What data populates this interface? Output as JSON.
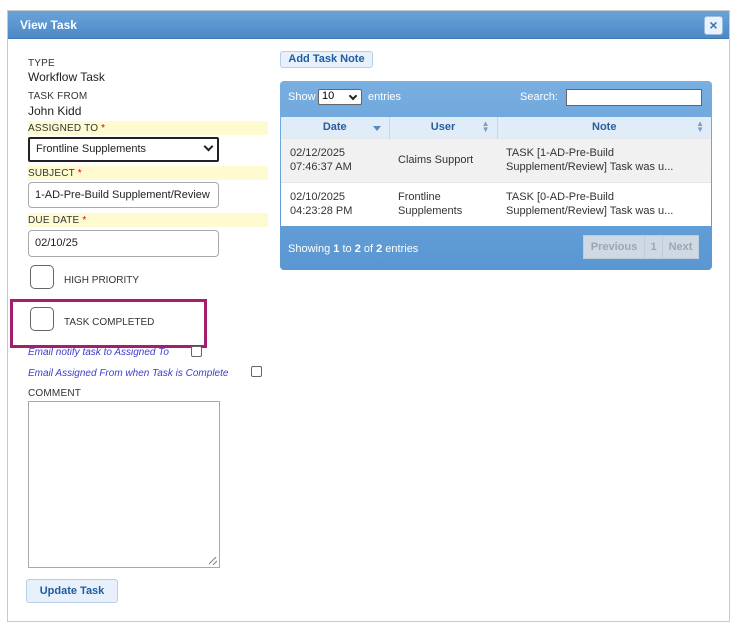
{
  "dialog": {
    "title": "View Task",
    "close_icon": "close-icon"
  },
  "form": {
    "type_label": "TYPE",
    "type_value": "Workflow Task",
    "task_from_label": "TASK FROM",
    "task_from_value": "John Kidd",
    "assigned_to_label": "ASSIGNED TO",
    "assigned_to_value": "Frontline Supplements",
    "subject_label": "SUBJECT",
    "subject_value": "1-AD-Pre-Build Supplement/Review",
    "due_date_label": "DUE DATE",
    "due_date_value": "02/10/25",
    "required_mark": "*",
    "high_priority_label": "HIGH PRIORITY",
    "task_completed_label": "TASK COMPLETED",
    "email_notify_label": "Email notify task to Assigned To",
    "email_assigned_from_label": "Email Assigned From when Task is Complete",
    "comment_label": "COMMENT",
    "comment_value": "",
    "update_button": "Update Task"
  },
  "notes": {
    "add_button": "Add Task Note",
    "show_label": "Show",
    "show_value": "10",
    "entries_label": "entries",
    "search_label": "Search:",
    "search_value": "",
    "columns": [
      "Date",
      "User",
      "Note"
    ],
    "rows": [
      {
        "date_line1": "02/12/2025",
        "date_line2": "07:46:37 AM",
        "user": "Claims Support",
        "note_line1": "TASK [1-AD-Pre-Build",
        "note_line2": "Supplement/Review] Task was u..."
      },
      {
        "date_line1": "02/10/2025",
        "date_line2": "04:23:28 PM",
        "user": "Frontline Supplements",
        "note_line1": "TASK [0-AD-Pre-Build",
        "note_line2": "Supplement/Review] Task was u..."
      }
    ],
    "info_prefix": "Showing ",
    "info_start": "1",
    "info_to": " to ",
    "info_end": "2",
    "info_of": " of ",
    "info_total": "2",
    "info_suffix": " entries",
    "pager_previous": "Previous",
    "pager_page": "1",
    "pager_next": "Next"
  },
  "colors": {
    "accent": "#4c89c6",
    "highlight": "#a61e6b",
    "required_band": "#fdfbcf"
  }
}
